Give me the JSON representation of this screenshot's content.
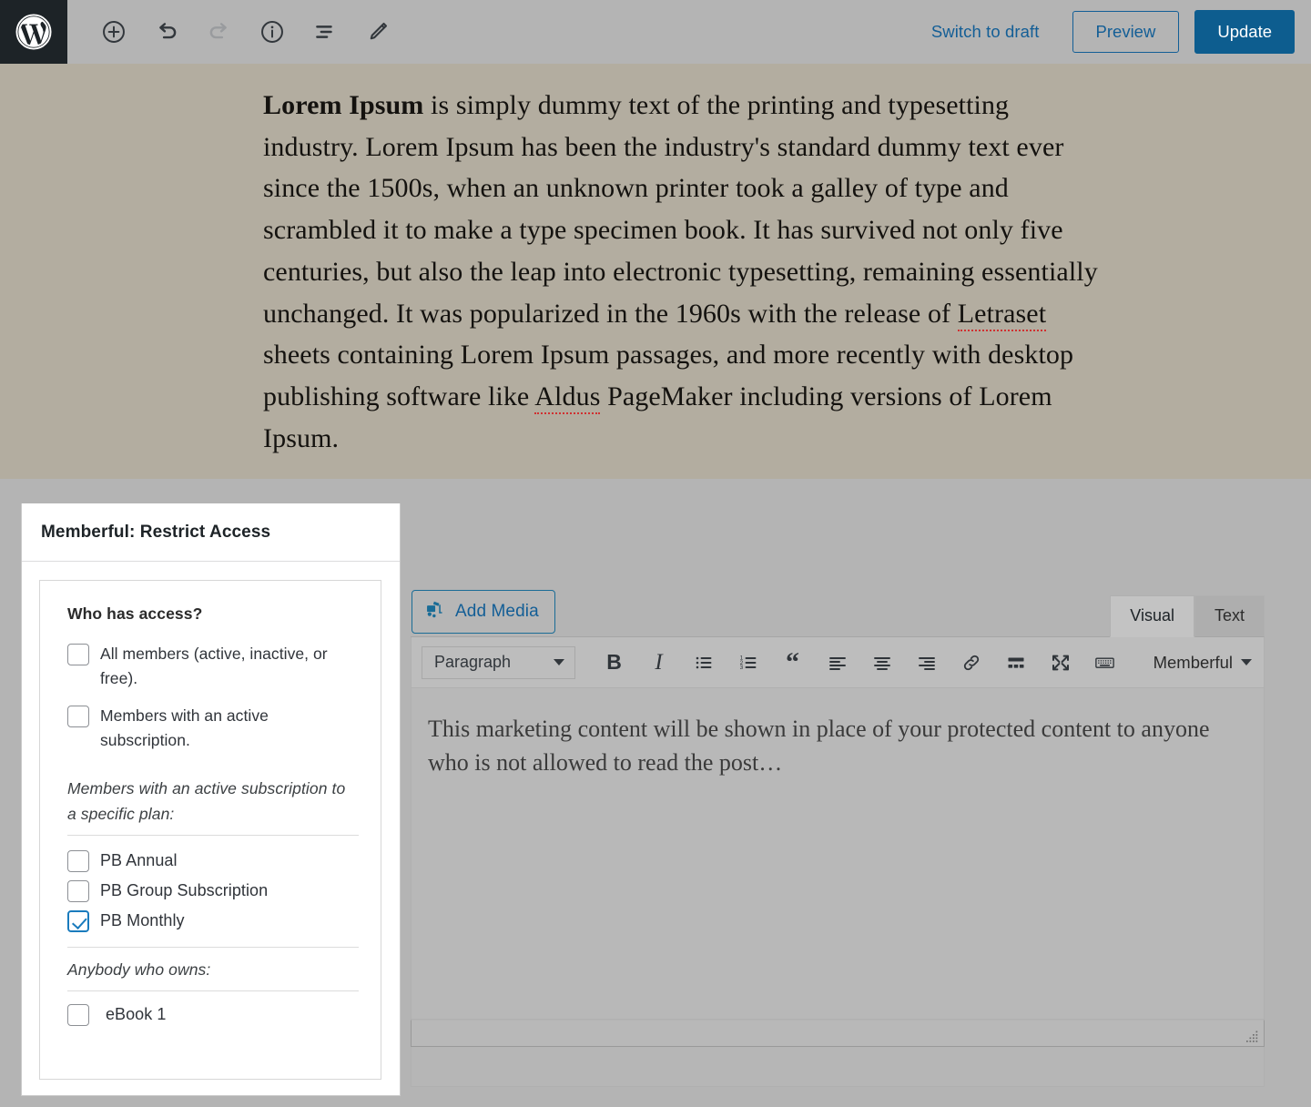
{
  "topbar": {
    "logo_icon": "wordpress-logo-icon",
    "tools": [
      {
        "name": "add-block-button",
        "icon": "plus-circle-icon",
        "disabled": false
      },
      {
        "name": "undo-button",
        "icon": "undo-icon",
        "disabled": false
      },
      {
        "name": "redo-button",
        "icon": "redo-icon",
        "disabled": true
      },
      {
        "name": "details-button",
        "icon": "info-circle-icon",
        "disabled": false
      },
      {
        "name": "list-view-button",
        "icon": "list-view-icon",
        "disabled": false
      },
      {
        "name": "edit-mode-button",
        "icon": "pencil-icon",
        "disabled": false
      }
    ],
    "switch_to_draft": "Switch to draft",
    "preview": "Preview",
    "update": "Update",
    "accent_link": "#135e96",
    "accent_button": "#0d5d8f"
  },
  "post": {
    "paragraph_lead": "Lorem Ipsum",
    "paragraph_rest_1": " is simply dummy text of the printing and typesetting industry. Lorem Ipsum has been the industry's standard dummy text ever since the 1500s, when an unknown printer took a galley of type and scrambled it to make a type specimen book. It has survived not only five centuries, but also the leap into electronic typesetting, remaining essentially unchanged. It was popularized in the 1960s with the release of ",
    "misspelled_1": "Letraset",
    "paragraph_rest_2": " sheets containing Lorem Ipsum passages, and more recently with desktop publishing software like ",
    "misspelled_2": "Aldus",
    "paragraph_rest_3": " PageMaker including versions of Lorem Ipsum.",
    "background_color": "#b3ada0"
  },
  "memberful_panel": {
    "title": "Memberful: Restrict Access",
    "section_title": "Who has access?",
    "access_options": [
      {
        "label": "All members (active, inactive, or free).",
        "checked": false
      },
      {
        "label": "Members with an active subscription.",
        "checked": false
      }
    ],
    "plans_heading": "Members with an active subscription to a specific plan:",
    "plans": [
      {
        "label": "PB Annual",
        "checked": false
      },
      {
        "label": "PB Group Subscription",
        "checked": false
      },
      {
        "label": "PB Monthly",
        "checked": true
      }
    ],
    "downloads_heading": "Anybody who owns:",
    "downloads": [
      {
        "label": "eBook 1",
        "checked": false
      }
    ],
    "checked_color": "#1a7bbd"
  },
  "editor": {
    "add_media_label": "Add Media",
    "add_media_icon": "media-library-icon",
    "tabs": [
      {
        "label": "Visual",
        "active": true
      },
      {
        "label": "Text",
        "active": false
      }
    ],
    "format_select": "Paragraph",
    "format_buttons": [
      {
        "name": "bold-button",
        "icon": "bold-icon",
        "glyph": "B"
      },
      {
        "name": "italic-button",
        "icon": "italic-icon",
        "glyph": "I"
      },
      {
        "name": "bulleted-list-button",
        "icon": "bulleted-list-icon"
      },
      {
        "name": "numbered-list-button",
        "icon": "numbered-list-icon"
      },
      {
        "name": "blockquote-button",
        "icon": "blockquote-icon",
        "glyph": "“"
      },
      {
        "name": "align-left-button",
        "icon": "align-left-icon"
      },
      {
        "name": "align-center-button",
        "icon": "align-center-icon"
      },
      {
        "name": "align-right-button",
        "icon": "align-right-icon"
      },
      {
        "name": "insert-link-button",
        "icon": "link-icon"
      },
      {
        "name": "read-more-button",
        "icon": "read-more-icon"
      },
      {
        "name": "fullscreen-button",
        "icon": "fullscreen-icon"
      },
      {
        "name": "toolbar-toggle-button",
        "icon": "keyboard-toolbar-icon"
      }
    ],
    "memberful_dropdown": "Memberful",
    "content": "This marketing content will be shown in place of your protected content to anyone who is not allowed to read the post…"
  }
}
